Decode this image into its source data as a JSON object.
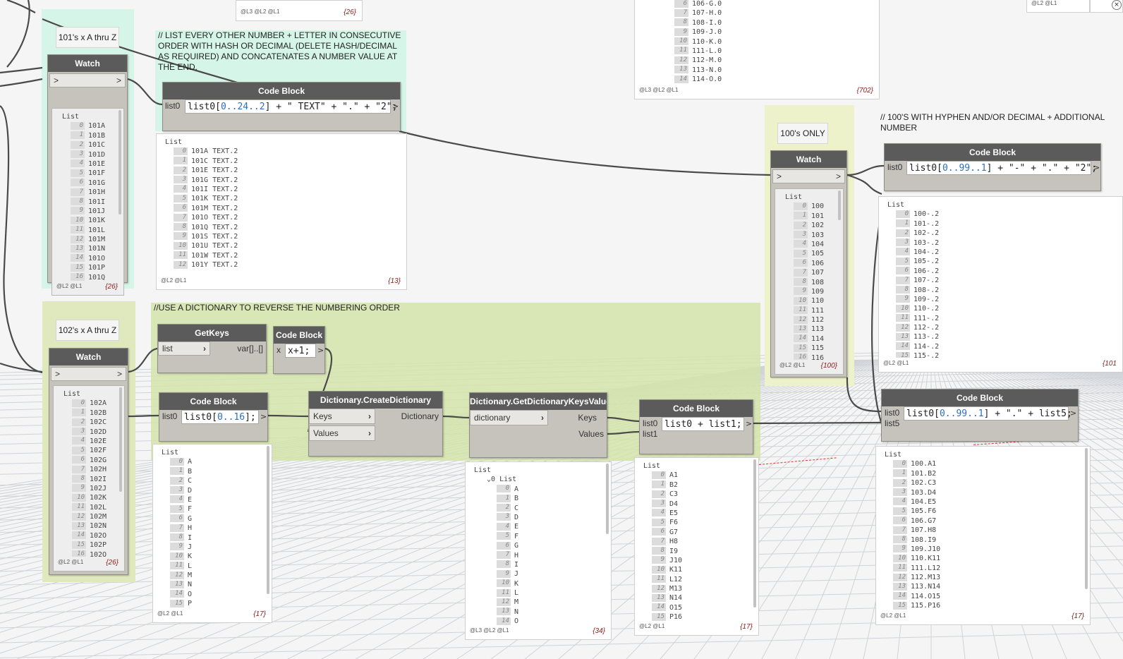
{
  "groups": {
    "every_other_title": "// LIST EVERY OTHER NUMBER + LETTER IN CONSECUTIVE ORDER WITH HASH OR DECIMAL (DELETE HASH/DECIMAL AS REQUIRED) AND CONCATENATES A NUMBER VALUE AT THE END.",
    "dictionary_title": "//USE A DICTIONARY TO REVERSE THE NUMBERING ORDER",
    "hyphen_title": "// 100'S WITH HYPHEN AND/OR DECIMAL + ADDITIONAL NUMBER"
  },
  "notes": {
    "n101": "101's x A thru Z",
    "n102": "102's x A thru Z",
    "n100": "100's ONLY"
  },
  "ports": {
    "arrow": ">"
  },
  "top_panels": {
    "left": {
      "levels": "@L3 @L2 @L1",
      "count": "{26}"
    },
    "mid": {
      "levels": "@L3 @L2 @L1",
      "count": "{702}",
      "rows": [
        [
          "6",
          "106-G.0"
        ],
        [
          "7",
          "107-H.0"
        ],
        [
          "8",
          "108-I.0"
        ],
        [
          "9",
          "109-J.0"
        ],
        [
          "10",
          "110-K.0"
        ],
        [
          "11",
          "111-L.0"
        ],
        [
          "12",
          "112-M.0"
        ],
        [
          "13",
          "113-N.0"
        ],
        [
          "14",
          "114-O.0"
        ]
      ]
    },
    "right": {
      "levels": "@L2 @L1"
    }
  },
  "nodes": {
    "watch_101": {
      "title": "Watch",
      "levels": "@L2 @L1",
      "count": "{26}",
      "rows": [
        [
          "0",
          "101A"
        ],
        [
          "1",
          "101B"
        ],
        [
          "2",
          "101C"
        ],
        [
          "3",
          "101D"
        ],
        [
          "4",
          "101E"
        ],
        [
          "5",
          "101F"
        ],
        [
          "6",
          "101G"
        ],
        [
          "7",
          "101H"
        ],
        [
          "8",
          "101I"
        ],
        [
          "9",
          "101J"
        ],
        [
          "10",
          "101K"
        ],
        [
          "11",
          "101L"
        ],
        [
          "12",
          "101M"
        ],
        [
          "13",
          "101N"
        ],
        [
          "14",
          "101O"
        ],
        [
          "15",
          "101P"
        ],
        [
          "16",
          "101Q"
        ]
      ]
    },
    "cb_every_other": {
      "title": "Code Block",
      "input": "list0",
      "code_parts": [
        [
          "list0[",
          ""
        ],
        [
          "0..24..2",
          "n"
        ],
        [
          "] + \" TEXT\" + \".\" + \"2\";",
          ""
        ]
      ],
      "levels": "@L2 @L1",
      "count": "{13}",
      "rows": [
        [
          "0",
          "101A TEXT.2"
        ],
        [
          "1",
          "101C TEXT.2"
        ],
        [
          "2",
          "101E TEXT.2"
        ],
        [
          "3",
          "101G TEXT.2"
        ],
        [
          "4",
          "101I TEXT.2"
        ],
        [
          "5",
          "101K TEXT.2"
        ],
        [
          "6",
          "101M TEXT.2"
        ],
        [
          "7",
          "101O TEXT.2"
        ],
        [
          "8",
          "101Q TEXT.2"
        ],
        [
          "9",
          "101S TEXT.2"
        ],
        [
          "10",
          "101U TEXT.2"
        ],
        [
          "11",
          "101W TEXT.2"
        ],
        [
          "12",
          "101Y TEXT.2"
        ]
      ]
    },
    "watch_102": {
      "title": "Watch",
      "levels": "@L2 @L1",
      "count": "{26}",
      "rows": [
        [
          "0",
          "102A"
        ],
        [
          "1",
          "102B"
        ],
        [
          "2",
          "102C"
        ],
        [
          "3",
          "102D"
        ],
        [
          "4",
          "102E"
        ],
        [
          "5",
          "102F"
        ],
        [
          "6",
          "102G"
        ],
        [
          "7",
          "102H"
        ],
        [
          "8",
          "102I"
        ],
        [
          "9",
          "102J"
        ],
        [
          "10",
          "102K"
        ],
        [
          "11",
          "102L"
        ],
        [
          "12",
          "102M"
        ],
        [
          "13",
          "102N"
        ],
        [
          "14",
          "102O"
        ],
        [
          "15",
          "102P"
        ],
        [
          "16",
          "102Q"
        ]
      ]
    },
    "getkeys": {
      "title": "GetKeys",
      "input": "list",
      "output": "var[]..[]"
    },
    "cb_inc": {
      "title": "Code Block",
      "input": "x",
      "code": "x+1;"
    },
    "cb_range16": {
      "title": "Code Block",
      "input": "list0",
      "code_parts": [
        [
          "list0[",
          ""
        ],
        [
          "0..16",
          "n"
        ],
        [
          "];",
          ""
        ]
      ],
      "levels": "@L2 @L1",
      "count": "{17}",
      "rows": [
        [
          "0",
          "A"
        ],
        [
          "1",
          "B"
        ],
        [
          "2",
          "C"
        ],
        [
          "3",
          "D"
        ],
        [
          "4",
          "E"
        ],
        [
          "5",
          "F"
        ],
        [
          "6",
          "G"
        ],
        [
          "7",
          "H"
        ],
        [
          "8",
          "I"
        ],
        [
          "9",
          "J"
        ],
        [
          "10",
          "K"
        ],
        [
          "11",
          "L"
        ],
        [
          "12",
          "M"
        ],
        [
          "13",
          "N"
        ],
        [
          "14",
          "O"
        ],
        [
          "15",
          "P"
        ]
      ]
    },
    "create_dict": {
      "title": "Dictionary.CreateDictionary",
      "inputs": [
        "Keys",
        "Values"
      ],
      "output": "Dictionary"
    },
    "get_kv": {
      "title": "Dictionary.GetDictionaryKeysValues",
      "input": "dictionary",
      "outputs": [
        "Keys",
        "Values"
      ],
      "levels": "@L3 @L2 @L1",
      "count": "{34}",
      "sublist": "List",
      "rows": [
        [
          "0",
          "A"
        ],
        [
          "1",
          "B"
        ],
        [
          "2",
          "C"
        ],
        [
          "3",
          "D"
        ],
        [
          "4",
          "E"
        ],
        [
          "5",
          "F"
        ],
        [
          "6",
          "G"
        ],
        [
          "7",
          "H"
        ],
        [
          "8",
          "I"
        ],
        [
          "9",
          "J"
        ],
        [
          "10",
          "K"
        ],
        [
          "11",
          "L"
        ],
        [
          "12",
          "M"
        ],
        [
          "13",
          "N"
        ],
        [
          "14",
          "O"
        ]
      ]
    },
    "cb_concat": {
      "title": "Code Block",
      "inputs": [
        "list0",
        "list1"
      ],
      "code": "list0 + list1;",
      "levels": "@L2 @L1",
      "count": "{17}",
      "rows": [
        [
          "0",
          "A1"
        ],
        [
          "1",
          "B2"
        ],
        [
          "2",
          "C3"
        ],
        [
          "3",
          "D4"
        ],
        [
          "4",
          "E5"
        ],
        [
          "5",
          "F6"
        ],
        [
          "6",
          "G7"
        ],
        [
          "7",
          "H8"
        ],
        [
          "8",
          "I9"
        ],
        [
          "9",
          "J10"
        ],
        [
          "10",
          "K11"
        ],
        [
          "11",
          "L12"
        ],
        [
          "12",
          "M13"
        ],
        [
          "13",
          "N14"
        ],
        [
          "14",
          "O15"
        ],
        [
          "15",
          "P16"
        ]
      ]
    },
    "watch_100": {
      "title": "Watch",
      "levels": "@L2 @L1",
      "count": "{100}",
      "rows": [
        [
          "0",
          "100"
        ],
        [
          "1",
          "101"
        ],
        [
          "2",
          "102"
        ],
        [
          "3",
          "103"
        ],
        [
          "4",
          "104"
        ],
        [
          "5",
          "105"
        ],
        [
          "6",
          "106"
        ],
        [
          "7",
          "107"
        ],
        [
          "8",
          "108"
        ],
        [
          "9",
          "109"
        ],
        [
          "10",
          "110"
        ],
        [
          "11",
          "111"
        ],
        [
          "12",
          "112"
        ],
        [
          "13",
          "113"
        ],
        [
          "14",
          "114"
        ],
        [
          "15",
          "115"
        ],
        [
          "16",
          "116"
        ]
      ]
    },
    "cb_hyphen": {
      "title": "Code Block",
      "input": "list0",
      "code_parts": [
        [
          "list0[",
          ""
        ],
        [
          "0..99..1",
          "n"
        ],
        [
          "] + \"-\" + \".\" + \"2\";",
          ""
        ]
      ],
      "levels": "@L2 @L1",
      "count": "{101",
      "rows": [
        [
          "0",
          "100-.2"
        ],
        [
          "1",
          "101-.2"
        ],
        [
          "2",
          "102-.2"
        ],
        [
          "3",
          "103-.2"
        ],
        [
          "4",
          "104-.2"
        ],
        [
          "5",
          "105-.2"
        ],
        [
          "6",
          "106-.2"
        ],
        [
          "7",
          "107-.2"
        ],
        [
          "8",
          "108-.2"
        ],
        [
          "9",
          "109-.2"
        ],
        [
          "10",
          "110-.2"
        ],
        [
          "11",
          "111-.2"
        ],
        [
          "12",
          "112-.2"
        ],
        [
          "13",
          "113-.2"
        ],
        [
          "14",
          "114-.2"
        ],
        [
          "15",
          "115-.2"
        ]
      ]
    },
    "cb_join": {
      "title": "Code Block",
      "inputs": [
        "list0",
        "list5"
      ],
      "code_parts": [
        [
          "list0[",
          ""
        ],
        [
          "0..99..1",
          "n"
        ],
        [
          "] + \".\" + list5;",
          ""
        ]
      ],
      "levels": "@L2 @L1",
      "count": "{17}",
      "rows": [
        [
          "0",
          "100.A1"
        ],
        [
          "1",
          "101.B2"
        ],
        [
          "2",
          "102.C3"
        ],
        [
          "3",
          "103.D4"
        ],
        [
          "4",
          "104.E5"
        ],
        [
          "5",
          "105.F6"
        ],
        [
          "6",
          "106.G7"
        ],
        [
          "7",
          "107.H8"
        ],
        [
          "8",
          "108.I9"
        ],
        [
          "9",
          "109.J10"
        ],
        [
          "10",
          "110.K11"
        ],
        [
          "11",
          "111.L12"
        ],
        [
          "12",
          "112.M13"
        ],
        [
          "13",
          "113.N14"
        ],
        [
          "14",
          "114.O15"
        ],
        [
          "15",
          "115.P16"
        ]
      ]
    }
  },
  "list_header": "List",
  "colors": {
    "node_header": "#5b5b5b",
    "node_body": "#c6c3bd",
    "group_mint": "#d5f5e8",
    "group_olive": "#dfe9bd",
    "number_literal": "#2c6fbf",
    "count_text": "#8b1c1c",
    "wire": "#4a4a4a"
  }
}
